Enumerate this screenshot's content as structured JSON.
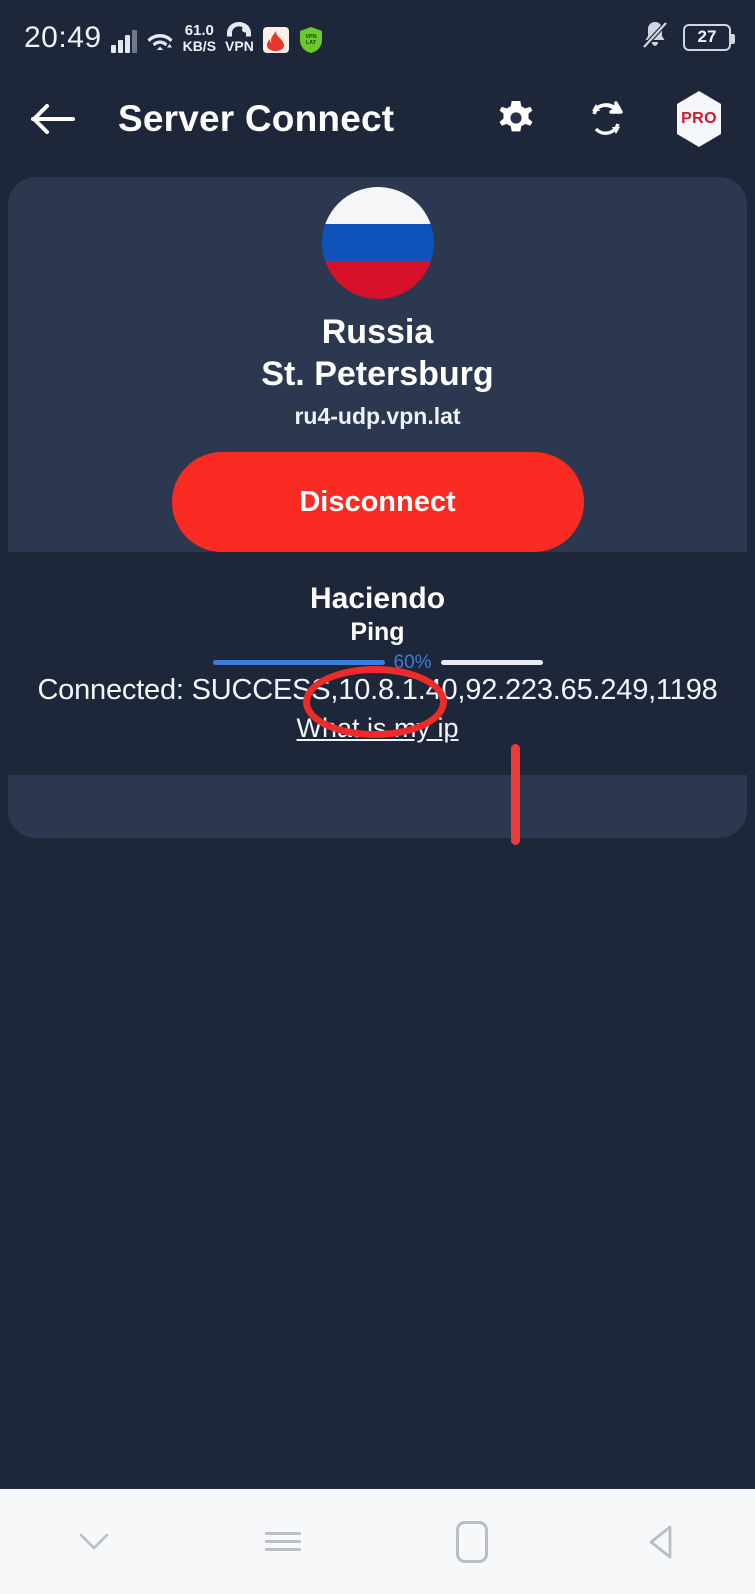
{
  "status_bar": {
    "time": "20:49",
    "signal_icon": "cellular-signal-icon",
    "wifi_icon": "wifi-icon",
    "net_speed_value": "61.0",
    "net_speed_unit": "KB/S",
    "vpn_label": "VPN",
    "vpn_icon": "vpn-key-icon",
    "app_icon_1": "flame-app-icon",
    "app_icon_2": "shield-vpn-app-icon",
    "notification_icon": "bell-muted-icon",
    "battery_level": "27",
    "battery_icon": "battery-icon"
  },
  "app_bar": {
    "back_icon": "back-arrow-icon",
    "title": "Server Connect",
    "settings_icon": "gear-icon",
    "refresh_icon": "refresh-icon",
    "pro_icon": "pro-hexagon-badge",
    "pro_label": "PRO"
  },
  "server_card": {
    "flag_icon": "russia-flag-icon",
    "flag_colors": [
      "#f4f6f8",
      "#0f52ba",
      "#d8112a"
    ],
    "country": "Russia",
    "city": "St. Petersburg",
    "hostname": "ru4-udp.vpn.lat",
    "disconnect_label": "Disconnect",
    "disconnect_color": "#f92b23"
  },
  "log_card": {
    "ping_title": "Haciendo",
    "ping_subtitle": "Ping",
    "progress_percent": "60%",
    "progress_value": 60,
    "progress_fill_color": "#3b7ddd",
    "progress_track_color": "#e9edf3",
    "status_line": "Connected: SUCCESS,10.8.1.40,92.223.65.249,1198",
    "what_is_my_ip_label": "What is my ip"
  },
  "annotations": {
    "ellipse_target": "10.8.1.40",
    "ellipse_color": "#ed2b2b",
    "line_color": "#ed3a3a"
  },
  "nav_bar": {
    "collapse_icon": "chevron-down-icon",
    "recents_icon": "hamburger-recents-icon",
    "home_icon": "home-square-icon",
    "back_icon": "back-triangle-icon"
  }
}
